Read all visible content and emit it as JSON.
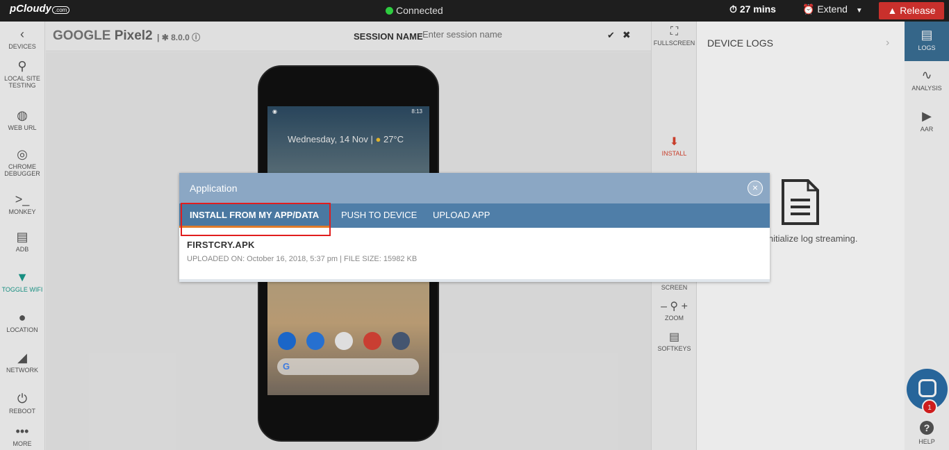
{
  "topbar": {
    "logo": "pCloudy",
    "logo_suffix": ".com",
    "status": "Connected",
    "timer": "27 mins",
    "extend": "Extend",
    "release": "Release"
  },
  "leftbar": [
    {
      "label": "DEVICES",
      "icon": "‹"
    },
    {
      "label": "LOCAL SITE TESTING",
      "icon": "⚲"
    },
    {
      "label": "WEB URL",
      "icon": "◍"
    },
    {
      "label": "CHROME DEBUGGER",
      "icon": "◎"
    },
    {
      "label": "MONKEY",
      "icon": ">_"
    },
    {
      "label": "ADB",
      "icon": "▤"
    },
    {
      "label": "TOGGLE WIFI",
      "icon": "▼"
    },
    {
      "label": "LOCATION",
      "icon": "●"
    },
    {
      "label": "NETWORK",
      "icon": "◢"
    },
    {
      "label": "REBOOT",
      "icon": "⏻"
    },
    {
      "label": "MORE",
      "icon": "•••"
    }
  ],
  "device": {
    "brand": "GOOGLE",
    "model": "Pixel2",
    "version": "8.0.0",
    "session_label": "SESSION NAME",
    "session_placeholder": "Enter session name",
    "phone_time": "8:13",
    "phone_date": "Wednesday, 14 Nov",
    "phone_temp": "27°C"
  },
  "tools": {
    "fullscreen": "FULLSCREEN",
    "install": "INSTALL",
    "screen": "SCREEN",
    "zoom": "ZOOM",
    "softkeys": "SOFTKEYS"
  },
  "logs": {
    "title": "DEVICE LOGS",
    "message": "initialize log streaming."
  },
  "farright": {
    "logs": "LOGS",
    "analysis": "ANALYSIS",
    "aar": "AAR",
    "help": "HELP",
    "badge": "1"
  },
  "modal": {
    "title": "Application",
    "tabs": [
      "INSTALL FROM MY APP/DATA",
      "PUSH TO DEVICE",
      "UPLOAD APP"
    ],
    "file_name": "FIRSTCRY.APK",
    "file_meta": "UPLOADED ON: October 16, 2018, 5:37 pm | FILE SIZE: 15982 KB"
  },
  "colors": {
    "accent": "#4f7ea8",
    "install": "#d9442f",
    "release": "#c9302c",
    "active_nav": "#1a9b8c"
  }
}
